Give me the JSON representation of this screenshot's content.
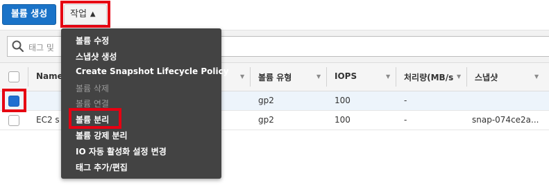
{
  "toolbar": {
    "create_volume_label": "볼륨 생성",
    "actions_label": "작업",
    "actions_caret": "▲"
  },
  "filter": {
    "placeholder": "태그 및"
  },
  "table": {
    "columns": {
      "name": "Name",
      "volume_type": "볼륨 유형",
      "iops": "IOPS",
      "throughput": "처리량(MB/s",
      "snapshot": "스냅샷"
    },
    "rows": [
      {
        "name": "",
        "volume_type": "gp2",
        "iops": "100",
        "throughput": "-",
        "snapshot": "",
        "selected": true
      },
      {
        "name": "EC2 s",
        "volume_type": "gp2",
        "iops": "100",
        "throughput": "-",
        "snapshot": "snap-074ce2a...",
        "selected": false
      }
    ]
  },
  "actions_menu": {
    "items": [
      {
        "label": "볼륨 수정",
        "enabled": true
      },
      {
        "label": "스냅샷 생성",
        "enabled": true
      },
      {
        "label": "Create Snapshot Lifecycle Policy",
        "enabled": true
      },
      {
        "label": "볼륨 삭제",
        "enabled": false
      },
      {
        "label": "볼륨 연결",
        "enabled": false
      },
      {
        "label": "볼륨 분리",
        "enabled": true
      },
      {
        "label": "볼륨 강제 분리",
        "enabled": true
      },
      {
        "label": "IO 자동 활성화 설정 변경",
        "enabled": true
      },
      {
        "label": "태그 추가/편집",
        "enabled": true
      }
    ]
  },
  "colors": {
    "primary_button": "#1a73c8",
    "highlight_box": "#e60012",
    "menu_background": "#434343",
    "checkbox_checked": "#1f6fd1"
  }
}
